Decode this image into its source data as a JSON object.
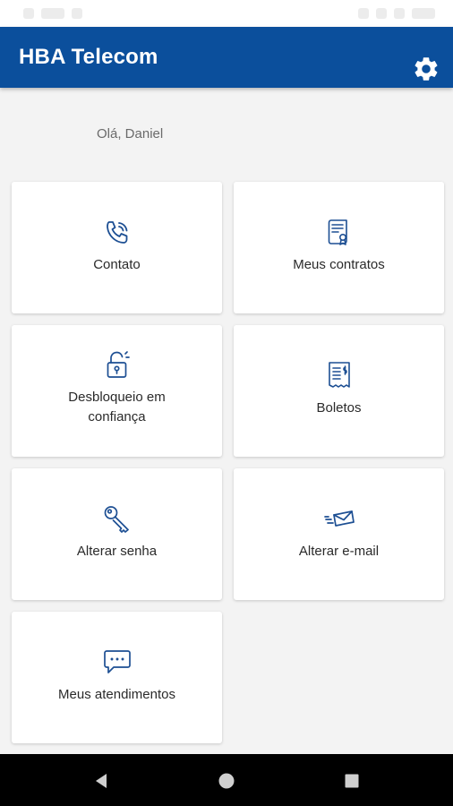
{
  "app": {
    "title": "HBA Telecom"
  },
  "greeting": "Olá, Daniel",
  "tiles": [
    {
      "label_lines": [
        "Contato"
      ],
      "icon": "phone-call-icon"
    },
    {
      "label_lines": [
        "Meus contratos"
      ],
      "icon": "contract-icon"
    },
    {
      "label_lines": [
        "Desbloqueio em",
        "confiança"
      ],
      "icon": "unlock-icon"
    },
    {
      "label_lines": [
        "Boletos"
      ],
      "icon": "invoice-icon"
    },
    {
      "label_lines": [
        "Alterar senha"
      ],
      "icon": "key-icon"
    },
    {
      "label_lines": [
        "Alterar e-mail"
      ],
      "icon": "envelope-icon"
    },
    {
      "label_lines": [
        "Meus atendimentos"
      ],
      "icon": "chat-bubble-icon"
    }
  ],
  "colors": {
    "primary": "#0b4f9c",
    "background": "#f3f3f3",
    "card": "#ffffff",
    "icon": "#1d4f93"
  }
}
